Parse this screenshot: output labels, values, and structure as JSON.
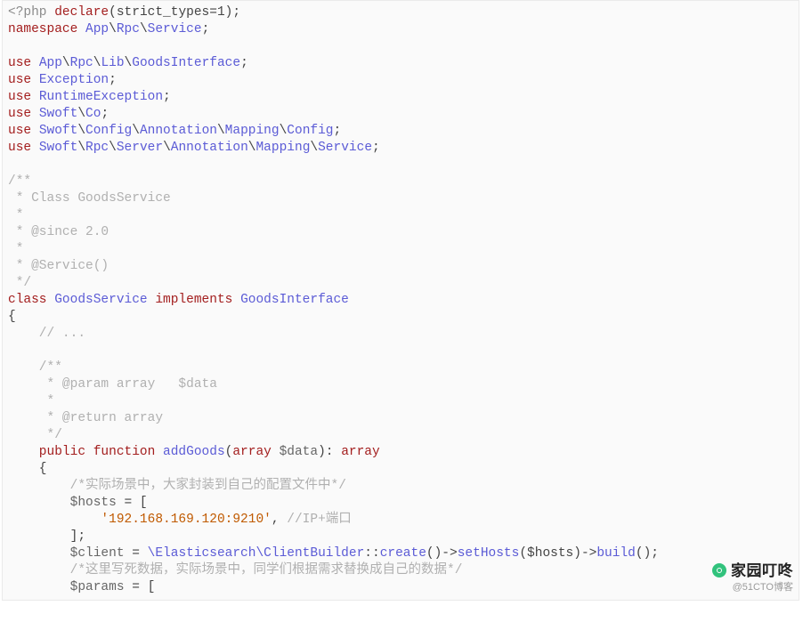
{
  "code": {
    "l1a": "<?php ",
    "l1b": "declare",
    "l1c": "(strict_types=1);",
    "l2a": "namespace ",
    "l2b": "App",
    "l2c": "\\",
    "l2d": "Rpc",
    "l2e": "\\",
    "l2f": "Service",
    "l2g": ";",
    "u1a": "use ",
    "u1b": "App",
    "u1c": "\\",
    "u1d": "Rpc",
    "u1e": "\\",
    "u1f": "Lib",
    "u1g": "\\",
    "u1h": "GoodsInterface",
    "u1i": ";",
    "u2a": "use ",
    "u2b": "Exception",
    "u2c": ";",
    "u3a": "use ",
    "u3b": "RuntimeException",
    "u3c": ";",
    "u4a": "use ",
    "u4b": "Swoft",
    "u4c": "\\",
    "u4d": "Co",
    "u4e": ";",
    "u5a": "use ",
    "u5b": "Swoft",
    "u5c": "\\",
    "u5d": "Config",
    "u5e": "\\",
    "u5f": "Annotation",
    "u5g": "\\",
    "u5h": "Mapping",
    "u5i": "\\",
    "u5j": "Config",
    "u5k": ";",
    "u6a": "use ",
    "u6b": "Swoft",
    "u6c": "\\",
    "u6d": "Rpc",
    "u6e": "\\",
    "u6f": "Server",
    "u6g": "\\",
    "u6h": "Annotation",
    "u6i": "\\",
    "u6j": "Mapping",
    "u6k": "\\",
    "u6l": "Service",
    "u6m": ";",
    "d1": "/**",
    "d2": " * Class GoodsService",
    "d3": " *",
    "d4": " * @since 2.0",
    "d5": " *",
    "d6": " * @Service()",
    "d7": " */",
    "cla": "class ",
    "clb": "GoodsService ",
    "clc": "implements ",
    "cld": "GoodsInterface",
    "br1": "{",
    "cm1": "    // ...",
    "pd1": "    /**",
    "pd2": "     * @param array   $data",
    "pd3": "     *",
    "pd4": "     * @return array",
    "pd5": "     */",
    "fa": "    public function ",
    "fb": "addGoods",
    "fc": "(",
    "fd": "array ",
    "fe": "$data",
    "ff": "): ",
    "fg": "array",
    "br2": "    {",
    "c1": "        /*实际场景中，大家封装到自己的配置文件中*/",
    "h1a": "        $hosts ",
    "h1b": "= [",
    "h2a": "            '192.168.169.120:9210'",
    "h2b": ", ",
    "h2c": "//IP+端口",
    "h3": "        ];",
    "c2a": "        $client ",
    "c2b": "= ",
    "c2c": "\\Elasticsearch\\ClientBuilder",
    "c2d": "::",
    "c2e": "create",
    "c2f": "()->",
    "c2g": "setHosts",
    "c2h": "($hosts)->",
    "c2i": "build",
    "c2j": "();",
    "c3": "        /*这里写死数据，实际场景中，同学们根据需求替换成自己的数据*/",
    "p1a": "        $params ",
    "p1b": "= ["
  },
  "watermark": {
    "line1": "家园叮咚",
    "line2": "@51CTO博客"
  }
}
